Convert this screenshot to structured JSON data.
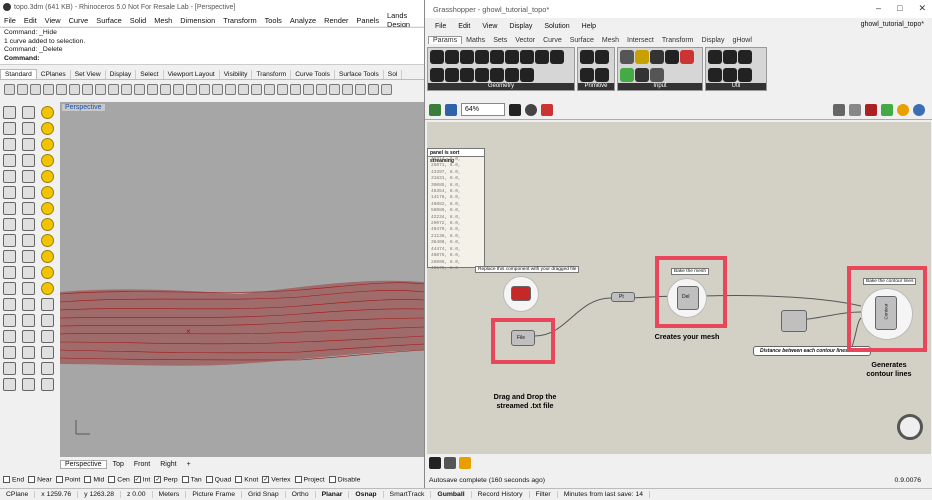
{
  "rhino": {
    "title": "topo.3dm (641 KB) - Rhinoceros 5.0 Not For Resale Lab - [Perspective]",
    "menu": [
      "File",
      "Edit",
      "View",
      "Curve",
      "Surface",
      "Solid",
      "Mesh",
      "Dimension",
      "Transform",
      "Tools",
      "Analyze",
      "Render",
      "Panels",
      "Lands Design"
    ],
    "command_history": [
      "Command: _Hide",
      "1 curve added to selection.",
      "Command: _Delete",
      "Command:"
    ],
    "toolbar_tabs": [
      "Standard",
      "CPlanes",
      "Set View",
      "Display",
      "Select",
      "Viewport Layout",
      "Visibility",
      "Transform",
      "Curve Tools",
      "Surface Tools",
      "Sol"
    ],
    "viewport_label": "Perspective",
    "viewport_tabs": [
      "Perspective",
      "Top",
      "Front",
      "Right"
    ],
    "osnaps": [
      {
        "label": "End",
        "checked": false
      },
      {
        "label": "Near",
        "checked": false
      },
      {
        "label": "Point",
        "checked": false
      },
      {
        "label": "Mid",
        "checked": false
      },
      {
        "label": "Cen",
        "checked": false
      },
      {
        "label": "Int",
        "checked": true
      },
      {
        "label": "Perp",
        "checked": true
      },
      {
        "label": "Tan",
        "checked": false
      },
      {
        "label": "Quad",
        "checked": false
      },
      {
        "label": "Knot",
        "checked": false
      },
      {
        "label": "Vertex",
        "checked": true
      },
      {
        "label": "Project",
        "checked": false
      },
      {
        "label": "Disable",
        "checked": false
      }
    ]
  },
  "status_bar": {
    "cplane": "CPlane",
    "x": "x 1259.76",
    "y": "y 1263.28",
    "z": "z 0.00",
    "units": "Meters",
    "layer": "Picture Frame",
    "grid_snap": "Grid Snap",
    "ortho": "Ortho",
    "planar": "Planar",
    "osnap": "Osnap",
    "smarttrack": "SmartTrack",
    "gumball": "Gumball",
    "record_history": "Record History",
    "filter": "Filter",
    "minutes": "Minutes from last save: 14"
  },
  "grasshopper": {
    "title": "Grasshopper - ghowl_tutorial_topo*",
    "doc_name": "ghowl_tutorial_topo*",
    "menu": [
      "File",
      "Edit",
      "View",
      "Display",
      "Solution",
      "Help"
    ],
    "tabs": [
      "Params",
      "Maths",
      "Sets",
      "Vector",
      "Curve",
      "Surface",
      "Mesh",
      "Intersect",
      "Transform",
      "Display",
      "gHowl"
    ],
    "ribbon_groups": [
      "Geometry",
      "Primitive",
      "Input",
      "Util"
    ],
    "zoom": "64%",
    "panel_header": "panel is sort streaming",
    "panel_lines": [
      "46314, 8.0,",
      "25071, 8.0,",
      "43397, 8.0,",
      "31831, 8.0,",
      "39085, 8.0,",
      "46354, 8.0,",
      "14178, 8.0,",
      "46082, 8.0,",
      "58086, 8.0,",
      "42234, 8.0,",
      "29072, 8.0,",
      "40470, 8.0,",
      "21138, 8.0,",
      "38408, 8.0,",
      "44474, 8.0,",
      "46076, 8.0,",
      "28008, 8.0,",
      "40178, 8.0"
    ],
    "tags": {
      "replace": "Replace this component with your dragged file",
      "bake_mesh": "Bake the mesh",
      "bake_contour": "Bake the contour lines",
      "distance": "Distance between each contour lines"
    },
    "notes": {
      "drag_drop": "Drag and Drop the streamed .txt file",
      "creates_mesh": "Creates your mesh",
      "generates_contour": "Generates contour lines"
    },
    "component_labels": {
      "file": "File",
      "mesh": "Del",
      "contour": "Contour",
      "pt": "Pt"
    },
    "autosave": "Autosave complete (160 seconds ago)",
    "version": "0.9.0076"
  }
}
